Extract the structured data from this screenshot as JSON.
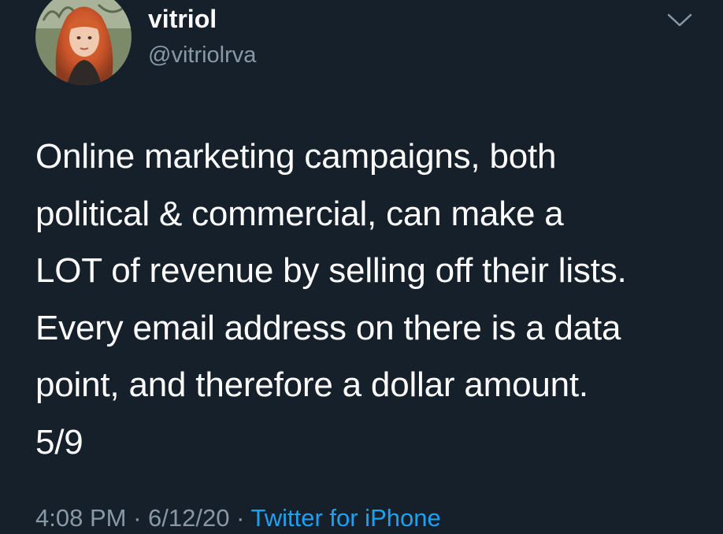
{
  "tweet": {
    "author": {
      "display_name": "vitriol",
      "handle": "@vitriolrva",
      "avatar_icon": "profile-photo"
    },
    "menu_icon": "chevron-down-icon",
    "text": "Online marketing campaigns, both\npolitical & commercial, can make a\nLOT of revenue by selling off their lists.\nEvery email address on there is a data\npoint, and therefore a dollar amount.\n5/9",
    "time": "4:08 PM",
    "separator": "·",
    "date": "6/12/20",
    "source": "Twitter for iPhone"
  },
  "colors": {
    "background": "#15202b",
    "text_primary": "#ffffff",
    "text_secondary": "#8899a6",
    "link": "#1da1f2"
  }
}
